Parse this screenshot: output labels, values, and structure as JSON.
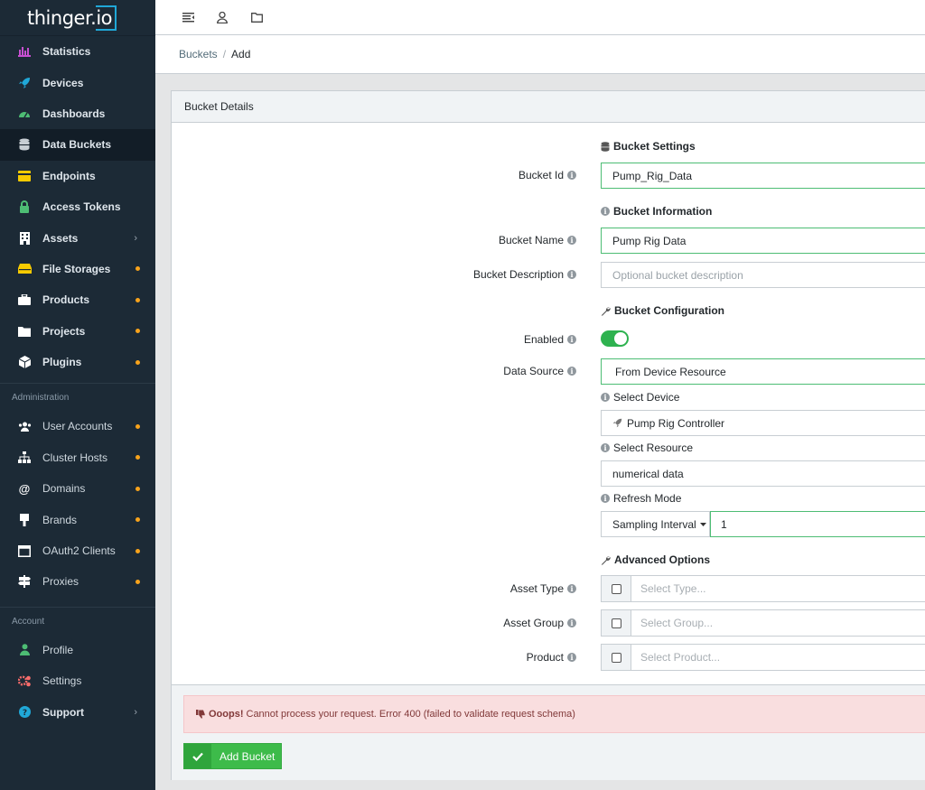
{
  "brand": {
    "text": "thinger.io",
    "accent": "#20a8d8"
  },
  "nav": {
    "main": [
      {
        "label": "Statistics",
        "icon": "chart-icon",
        "color": "#c64fd0"
      },
      {
        "label": "Devices",
        "icon": "rocket-icon",
        "color": "#20a8d8"
      },
      {
        "label": "Dashboards",
        "icon": "gauge-icon",
        "color": "#4dbd74"
      },
      {
        "label": "Data Buckets",
        "icon": "database-icon",
        "color": "#c8ced3",
        "active": true
      },
      {
        "label": "Endpoints",
        "icon": "endpoint-icon",
        "color": "#f8cb00"
      },
      {
        "label": "Access Tokens",
        "icon": "lock-icon",
        "color": "#4dbd74"
      },
      {
        "label": "Assets",
        "icon": "building-icon",
        "color": "#ffffff"
      },
      {
        "label": "File Storages",
        "icon": "storage-icon",
        "color": "#f8cb00"
      },
      {
        "label": "Products",
        "icon": "briefcase-icon",
        "color": "#ffffff"
      },
      {
        "label": "Projects",
        "icon": "folder-icon",
        "color": "#ffffff"
      },
      {
        "label": "Plugins",
        "icon": "cube-icon",
        "color": "#ffffff"
      }
    ],
    "administration_title": "Administration",
    "administration": [
      {
        "label": "User Accounts",
        "icon": "users-icon"
      },
      {
        "label": "Cluster Hosts",
        "icon": "sitemap-icon"
      },
      {
        "label": "Domains",
        "icon": "at-icon"
      },
      {
        "label": "Brands",
        "icon": "brush-icon"
      },
      {
        "label": "OAuth2 Clients",
        "icon": "window-icon"
      },
      {
        "label": "Proxies",
        "icon": "signpost-icon"
      }
    ],
    "account_title": "Account",
    "account": [
      {
        "label": "Profile",
        "icon": "user-icon",
        "color": "#4dbd74"
      },
      {
        "label": "Settings",
        "icon": "cogs-icon",
        "color": "#f86c6b"
      },
      {
        "label": "Support",
        "icon": "question-icon",
        "color": "#20a8d8"
      }
    ]
  },
  "breadcrumb": {
    "parent": "Buckets",
    "separator": "/",
    "current": "Add"
  },
  "card": {
    "header": "Bucket Details",
    "sections": {
      "settings": "Bucket Settings",
      "information": "Bucket Information",
      "configuration": "Bucket Configuration",
      "advanced": "Advanced Options"
    },
    "fields": {
      "bucket_id_label": "Bucket Id",
      "bucket_id_value": "Pump_Rig_Data",
      "bucket_name_label": "Bucket Name",
      "bucket_name_value": "Pump Rig Data",
      "bucket_description_label": "Bucket Description",
      "bucket_description_placeholder": "Optional bucket description",
      "enabled_label": "Enabled",
      "data_source_label": "Data Source",
      "data_source_value": "From Device Resource",
      "select_device_label": "Select Device",
      "select_device_value": "Pump Rig Controller",
      "select_resource_label": "Select Resource",
      "select_resource_value": "numerical data",
      "refresh_mode_label": "Refresh Mode",
      "refresh_mode_value": "Sampling Interval",
      "refresh_interval_value": "1",
      "asset_type_label": "Asset Type",
      "asset_type_placeholder": "Select Type...",
      "asset_group_label": "Asset Group",
      "asset_group_placeholder": "Select Group...",
      "product_label": "Product",
      "product_placeholder": "Select Product..."
    },
    "alert": {
      "title": "Ooops!",
      "message": "Cannot process your request. Error 400 (failed to validate request schema)"
    },
    "submit_label": "Add Bucket"
  }
}
